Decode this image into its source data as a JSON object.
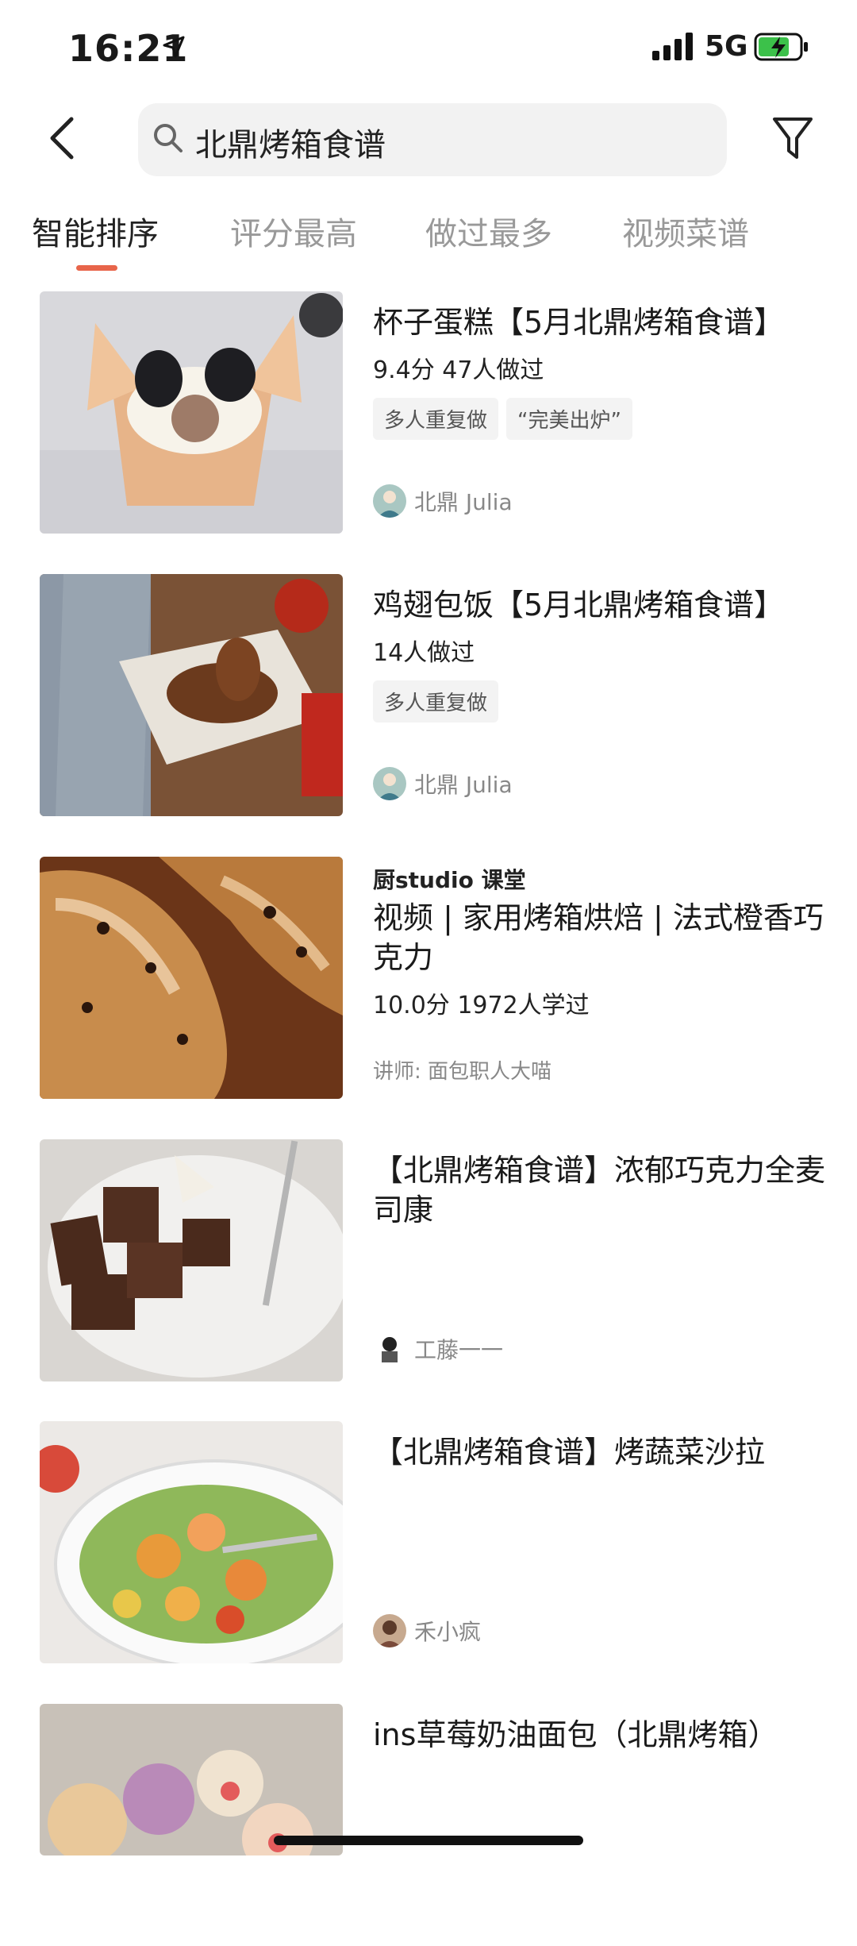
{
  "status": {
    "time": "16:21",
    "network": "5G"
  },
  "search": {
    "query": "北鼎烤箱食谱"
  },
  "tabs": [
    "智能排序",
    "评分最高",
    "做过最多",
    "视频菜谱"
  ],
  "items": [
    {
      "title": "杯子蛋糕【5月北鼎烤箱食谱】",
      "meta": "9.4分 47人做过",
      "tags": [
        "多人重复做",
        "“完美出炉”"
      ],
      "author": "北鼎 Julia"
    },
    {
      "title": "鸡翅包饭【5月北鼎烤箱食谱】",
      "meta": "14人做过",
      "tags": [
        "多人重复做"
      ],
      "author": "北鼎 Julia"
    },
    {
      "brand": "厨studio 课堂",
      "title": "视频 | 家用烤箱烘焙 | 法式橙香巧克力",
      "meta": "10.0分 1972人学过",
      "lecturer": "讲师: 面包职人大喵"
    },
    {
      "title": "【北鼎烤箱食谱】浓郁巧克力全麦司康",
      "author": "工藤一一"
    },
    {
      "title": "【北鼎烤箱食谱】烤蔬菜沙拉",
      "author": "禾小疯"
    },
    {
      "title": "ins草莓奶油面包（北鼎烤箱）"
    }
  ]
}
